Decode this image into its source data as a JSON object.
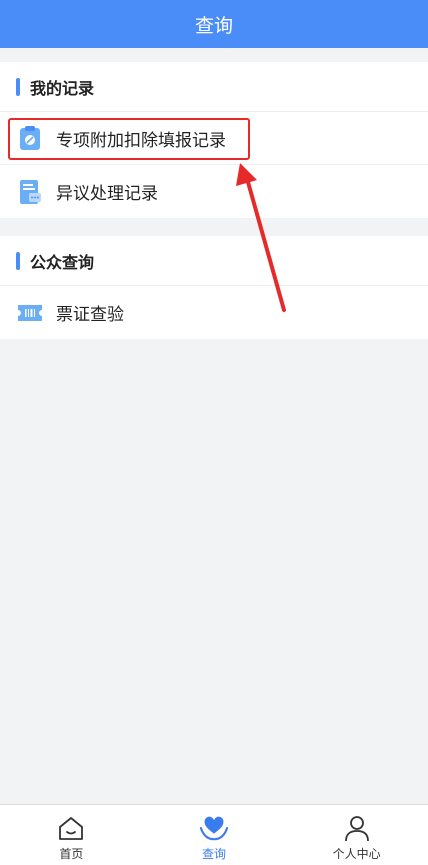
{
  "header": {
    "title": "查询"
  },
  "my_records": {
    "title": "我的记录",
    "items": [
      {
        "label": "专项附加扣除填报记录",
        "icon": "clipboard-icon"
      },
      {
        "label": "异议处理记录",
        "icon": "document-chat-icon"
      }
    ]
  },
  "public_query": {
    "title": "公众查询",
    "items": [
      {
        "label": "票证查验",
        "icon": "ticket-icon"
      }
    ]
  },
  "tabbar": {
    "items": [
      {
        "label": "首页",
        "icon": "home-icon",
        "active": false
      },
      {
        "label": "查询",
        "icon": "heart-hand-icon",
        "active": true
      },
      {
        "label": "个人中心",
        "icon": "person-icon",
        "active": false
      }
    ]
  },
  "colors": {
    "primary": "#4b8df8",
    "highlight": "#e62a2a",
    "background": "#f2f3f5"
  }
}
